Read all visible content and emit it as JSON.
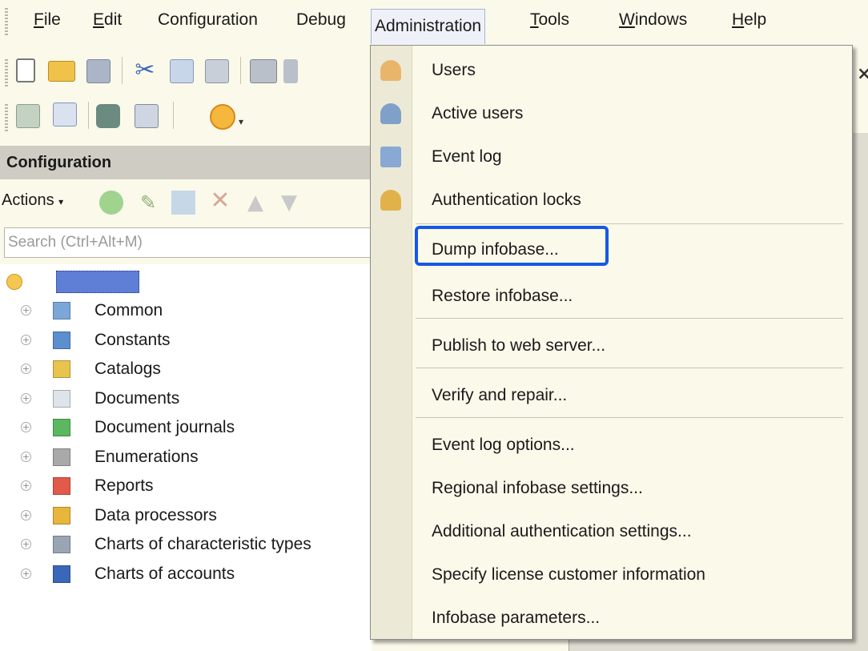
{
  "menubar": {
    "items": [
      {
        "label": "File",
        "hotkey": "F",
        "rest": "ile"
      },
      {
        "label": "Edit",
        "hotkey": "E",
        "rest": "dit"
      },
      {
        "label": "Configuration"
      },
      {
        "label": "Debug"
      },
      {
        "label": "Administration"
      },
      {
        "label": "Tools",
        "hotkey": "T",
        "rest": "ools"
      },
      {
        "label": "Windows",
        "hotkey": "W",
        "rest": "indows"
      },
      {
        "label": "Help",
        "hotkey": "H",
        "rest": "elp"
      }
    ]
  },
  "config_panel": {
    "title": "Configuration",
    "actions_label": "Actions",
    "search_placeholder": "Search (Ctrl+Alt+M)",
    "tree": [
      {
        "label": "Common",
        "icon": "common-icon"
      },
      {
        "label": "Constants",
        "icon": "constants-icon"
      },
      {
        "label": "Catalogs",
        "icon": "catalogs-icon"
      },
      {
        "label": "Documents",
        "icon": "documents-icon"
      },
      {
        "label": "Document journals",
        "icon": "document-journals-icon"
      },
      {
        "label": "Enumerations",
        "icon": "enumerations-icon"
      },
      {
        "label": "Reports",
        "icon": "reports-icon"
      },
      {
        "label": "Data processors",
        "icon": "data-processors-icon"
      },
      {
        "label": "Charts of characteristic types",
        "icon": "charts-of-characteristic-types-icon"
      },
      {
        "label": "Charts of accounts",
        "icon": "charts-of-accounts-icon"
      }
    ]
  },
  "admin_menu": {
    "items": [
      {
        "label": "Users"
      },
      {
        "label": "Active users"
      },
      {
        "label": "Event log"
      },
      {
        "label": "Authentication locks"
      },
      {
        "label": "Dump infobase..."
      },
      {
        "label": "Restore infobase..."
      },
      {
        "label": "Publish to web server..."
      },
      {
        "label": "Verify and repair..."
      },
      {
        "label": "Event log options..."
      },
      {
        "label": "Regional infobase settings..."
      },
      {
        "label": "Additional authentication settings..."
      },
      {
        "label": "Specify license customer information"
      },
      {
        "label": "Infobase parameters..."
      }
    ],
    "highlight_color": "#1558e8"
  }
}
